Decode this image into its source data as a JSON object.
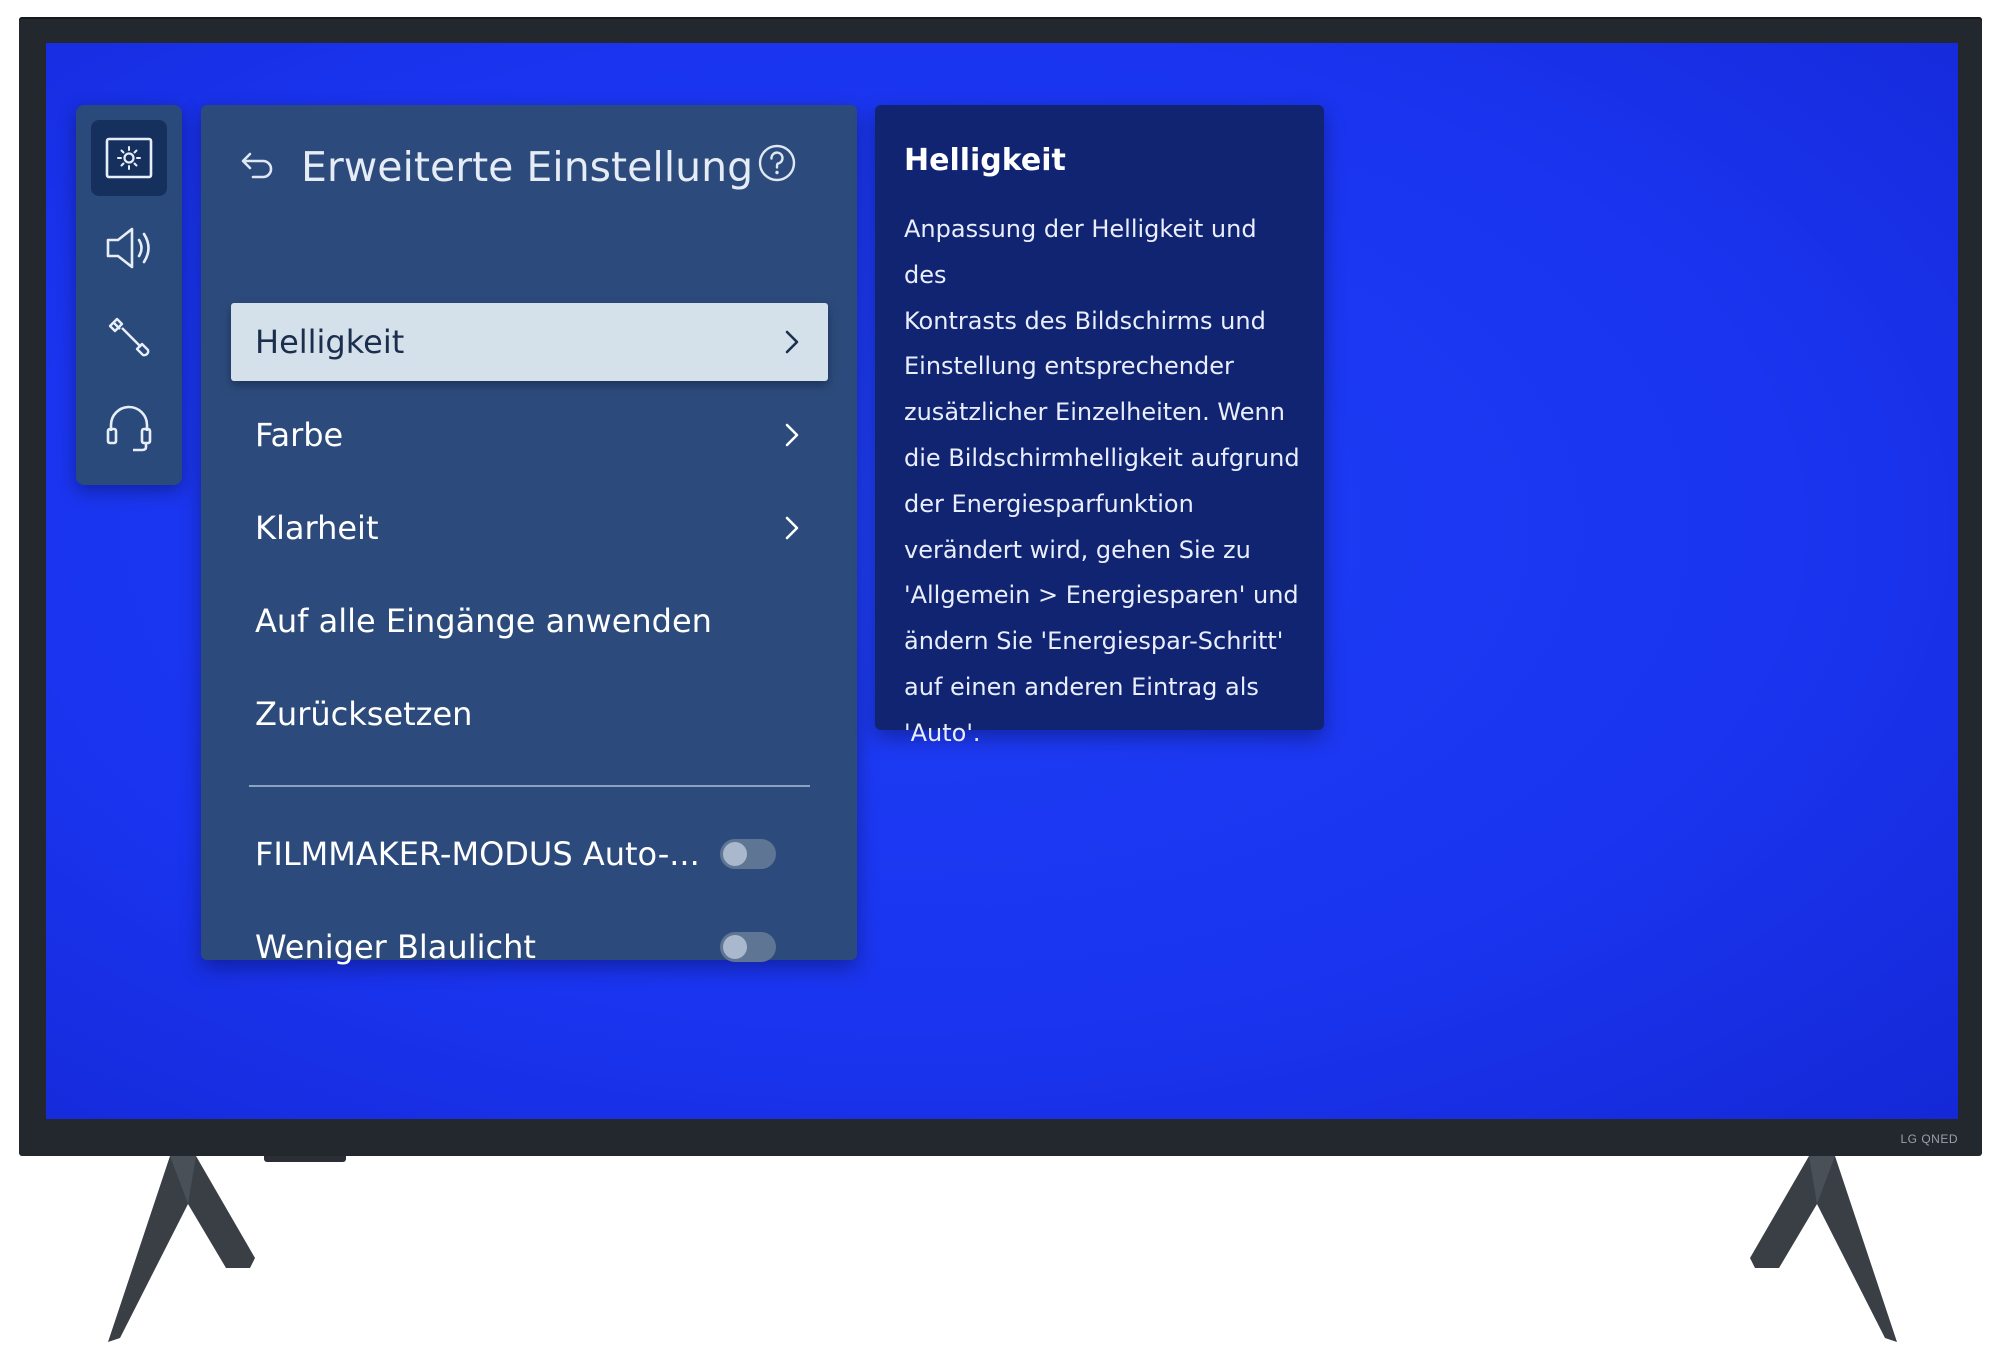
{
  "tv": {
    "brand": "LG QNED"
  },
  "sidebar": {
    "items": [
      {
        "id": "picture",
        "icon": "picture-settings-icon",
        "active": true
      },
      {
        "id": "sound",
        "icon": "speaker-icon",
        "active": false
      },
      {
        "id": "general",
        "icon": "wrench-icon",
        "active": false
      },
      {
        "id": "support",
        "icon": "headset-icon",
        "active": false
      }
    ]
  },
  "panel": {
    "title": "Erweiterte Einstellung",
    "back_icon": "back-arrow-icon",
    "help_icon": "help-icon",
    "menu_items": [
      {
        "label": "Helligkeit",
        "has_submenu": true,
        "focused": true
      },
      {
        "label": "Farbe",
        "has_submenu": true,
        "focused": false
      },
      {
        "label": "Klarheit",
        "has_submenu": true,
        "focused": false
      },
      {
        "label": "Auf alle Eingänge anwenden",
        "has_submenu": false,
        "focused": false
      },
      {
        "label": "Zurücksetzen",
        "has_submenu": false,
        "focused": false
      }
    ],
    "toggles": [
      {
        "label": "FILMMAKER-MODUS Auto-...",
        "on": false
      },
      {
        "label": "Weniger Blaulicht",
        "on": false
      }
    ]
  },
  "info": {
    "title": "Helligkeit",
    "lines": [
      "Anpassung der Helligkeit und des",
      "Kontrasts des Bildschirms und",
      "Einstellung entsprechender",
      "zusätzlicher Einzelheiten. Wenn",
      "die Bildschirmhelligkeit aufgrund",
      "der Energiesparfunktion",
      "verändert wird, gehen Sie zu",
      "'Allgemein > Energiesparen' und",
      "ändern Sie 'Energiespar-Schritt'",
      "auf einen anderen Eintrag als",
      "'Auto'."
    ]
  },
  "colors": {
    "screen": "#1a34ef",
    "panel": "#2c4b7c",
    "info_panel": "#112472",
    "focused_item": "#d4e0ea"
  }
}
